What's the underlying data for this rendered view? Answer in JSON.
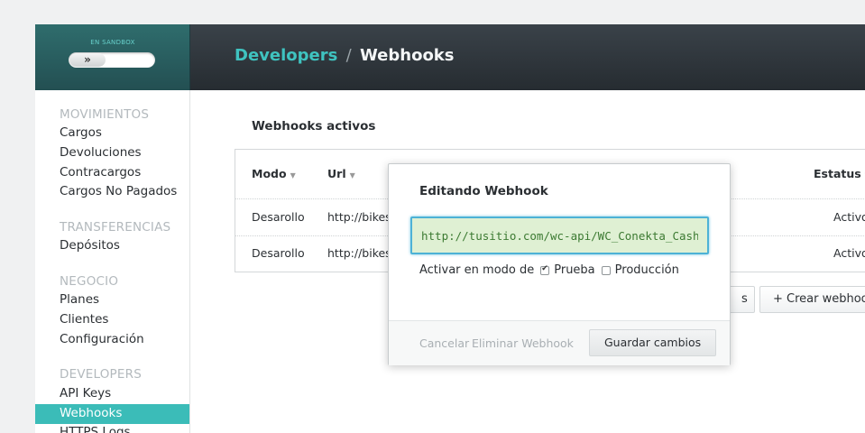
{
  "header": {
    "sandbox_label": "EN SANDBOX",
    "sandbox_knob": "»",
    "breadcrumb_parent": "Developers",
    "breadcrumb_sep": "/",
    "breadcrumb_current": "Webhooks"
  },
  "sidebar": {
    "sections": [
      {
        "title": "MOVIMIENTOS",
        "items": [
          "Cargos",
          "Devoluciones",
          "Contracargos",
          "Cargos No Pagados"
        ]
      },
      {
        "title": "TRANSFERENCIAS",
        "items": [
          "Depósitos"
        ]
      },
      {
        "title": "NEGOCIO",
        "items": [
          "Planes",
          "Clientes",
          "Configuración"
        ]
      },
      {
        "title": "DEVELOPERS",
        "items": [
          "API Keys",
          "Webhooks",
          "HTTPS Logs"
        ]
      }
    ],
    "active_item": "Webhooks",
    "active_color": "#3bbcb8"
  },
  "main": {
    "title": "Webhooks activos",
    "columns": [
      "Modo",
      "Url",
      "Estatus"
    ],
    "rows": [
      {
        "mode": "Desarollo",
        "url": "http://bikes",
        "status": "Activo"
      },
      {
        "mode": "Desarollo",
        "url": "http://bikes",
        "status": "Activo"
      }
    ],
    "buttons": {
      "partial": "s",
      "create": "+ Crear webhoo"
    }
  },
  "modal": {
    "title": "Editando Webhook",
    "url_value": "http://tusitio.com/wc-api/WC_Conekta_Cash_Ga",
    "mode_label": "Activar en modo de",
    "options": [
      {
        "label": "Prueba",
        "checked": true
      },
      {
        "label": "Producción",
        "checked": false
      }
    ],
    "cancel_label": "Cancelar",
    "delete_label": "Eliminar Webhook",
    "save_label": "Guardar cambios"
  }
}
